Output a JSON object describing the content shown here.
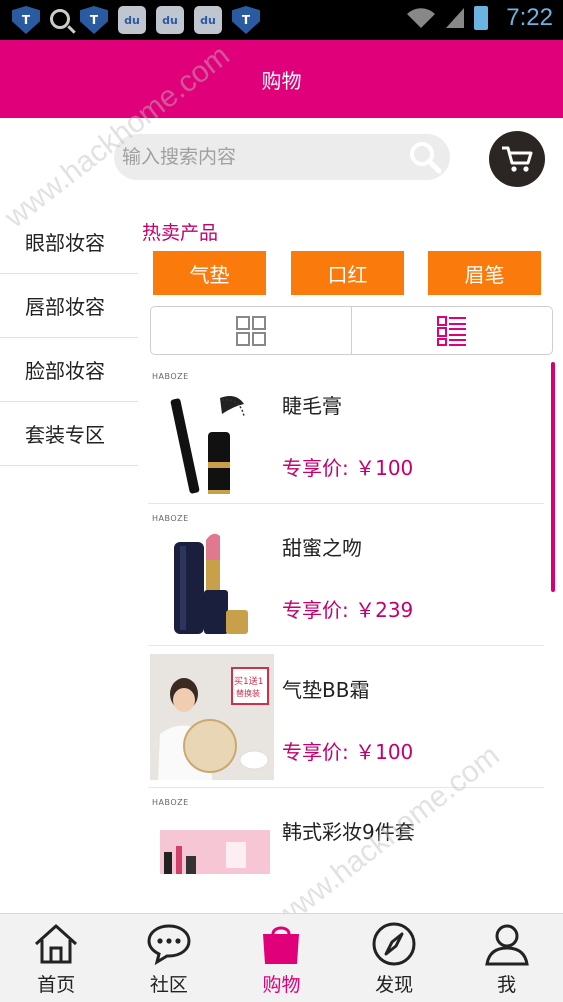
{
  "status_bar": {
    "time": "7:22"
  },
  "header": {
    "title": "购物"
  },
  "search": {
    "placeholder": "输入搜索内容"
  },
  "sidebar": {
    "items": [
      {
        "label": "眼部妆容"
      },
      {
        "label": "唇部妆容"
      },
      {
        "label": "脸部妆容"
      },
      {
        "label": "套装专区"
      }
    ]
  },
  "hot": {
    "title": "热卖产品",
    "tags": [
      {
        "label": "气垫"
      },
      {
        "label": "口红"
      },
      {
        "label": "眉笔"
      }
    ]
  },
  "products": [
    {
      "name": "睫毛膏",
      "price_label": "专享价:",
      "price": "￥100",
      "brand": "HABOZE"
    },
    {
      "name": "甜蜜之吻",
      "price_label": "专享价:",
      "price": "￥239",
      "brand": "HABOZE"
    },
    {
      "name": "气垫BB霜",
      "price_label": "专享价:",
      "price": "￥100",
      "promo": "买1送1",
      "promo_sub": "替换装"
    },
    {
      "name": "韩式彩妆9件套",
      "brand": "HABOZE"
    }
  ],
  "bottom_nav": {
    "items": [
      {
        "label": "首页",
        "icon": "home-icon"
      },
      {
        "label": "社区",
        "icon": "chat-icon"
      },
      {
        "label": "购物",
        "icon": "shopping-bag-icon",
        "active": true
      },
      {
        "label": "发现",
        "icon": "compass-icon"
      },
      {
        "label": "我",
        "icon": "user-icon"
      }
    ]
  },
  "colors": {
    "brand": "#e0007a",
    "tag": "#fb7a0c",
    "price": "#c4006d"
  },
  "watermark": "www.hackhome.com"
}
